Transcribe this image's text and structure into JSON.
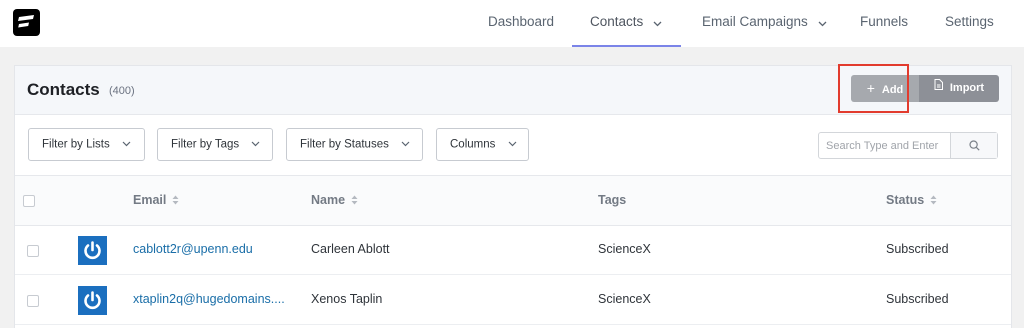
{
  "nav": {
    "items": [
      {
        "label": "Dashboard",
        "has_dropdown": false,
        "active": false
      },
      {
        "label": "Contacts",
        "has_dropdown": true,
        "active": true
      },
      {
        "label": "Email Campaigns",
        "has_dropdown": true,
        "active": false
      },
      {
        "label": "Funnels",
        "has_dropdown": false,
        "active": false
      },
      {
        "label": "Settings",
        "has_dropdown": false,
        "active": false
      }
    ]
  },
  "header": {
    "title": "Contacts",
    "count": "(400)",
    "add_label": "Add",
    "import_label": "Import"
  },
  "filters": [
    {
      "label": "Filter by Lists"
    },
    {
      "label": "Filter by Tags"
    },
    {
      "label": "Filter by Statuses"
    },
    {
      "label": "Columns"
    }
  ],
  "search": {
    "placeholder": "Search Type and Enter",
    "value": ""
  },
  "table": {
    "columns": {
      "email": "Email",
      "name": "Name",
      "tags": "Tags",
      "status": "Status"
    },
    "rows": [
      {
        "email": "cablott2r@upenn.edu",
        "name": "Carleen Ablott",
        "tags": "ScienceX",
        "status": "Subscribed"
      },
      {
        "email": "xtaplin2q@hugedomains....",
        "name": "Xenos Taplin",
        "tags": "ScienceX",
        "status": "Subscribed"
      }
    ]
  },
  "colors": {
    "accent_underline": "#7b84e8",
    "link": "#1a6ea8",
    "avatar_bg": "#1b6fbf",
    "highlight_box": "#e23b2e"
  },
  "icons": {
    "logo": "fluentcrm-logo-icon",
    "chevron": "chevron-down-icon",
    "sort": "sort-icon",
    "search": "search-icon",
    "add": "plus-icon",
    "import": "document-icon",
    "avatar": "power-icon"
  }
}
